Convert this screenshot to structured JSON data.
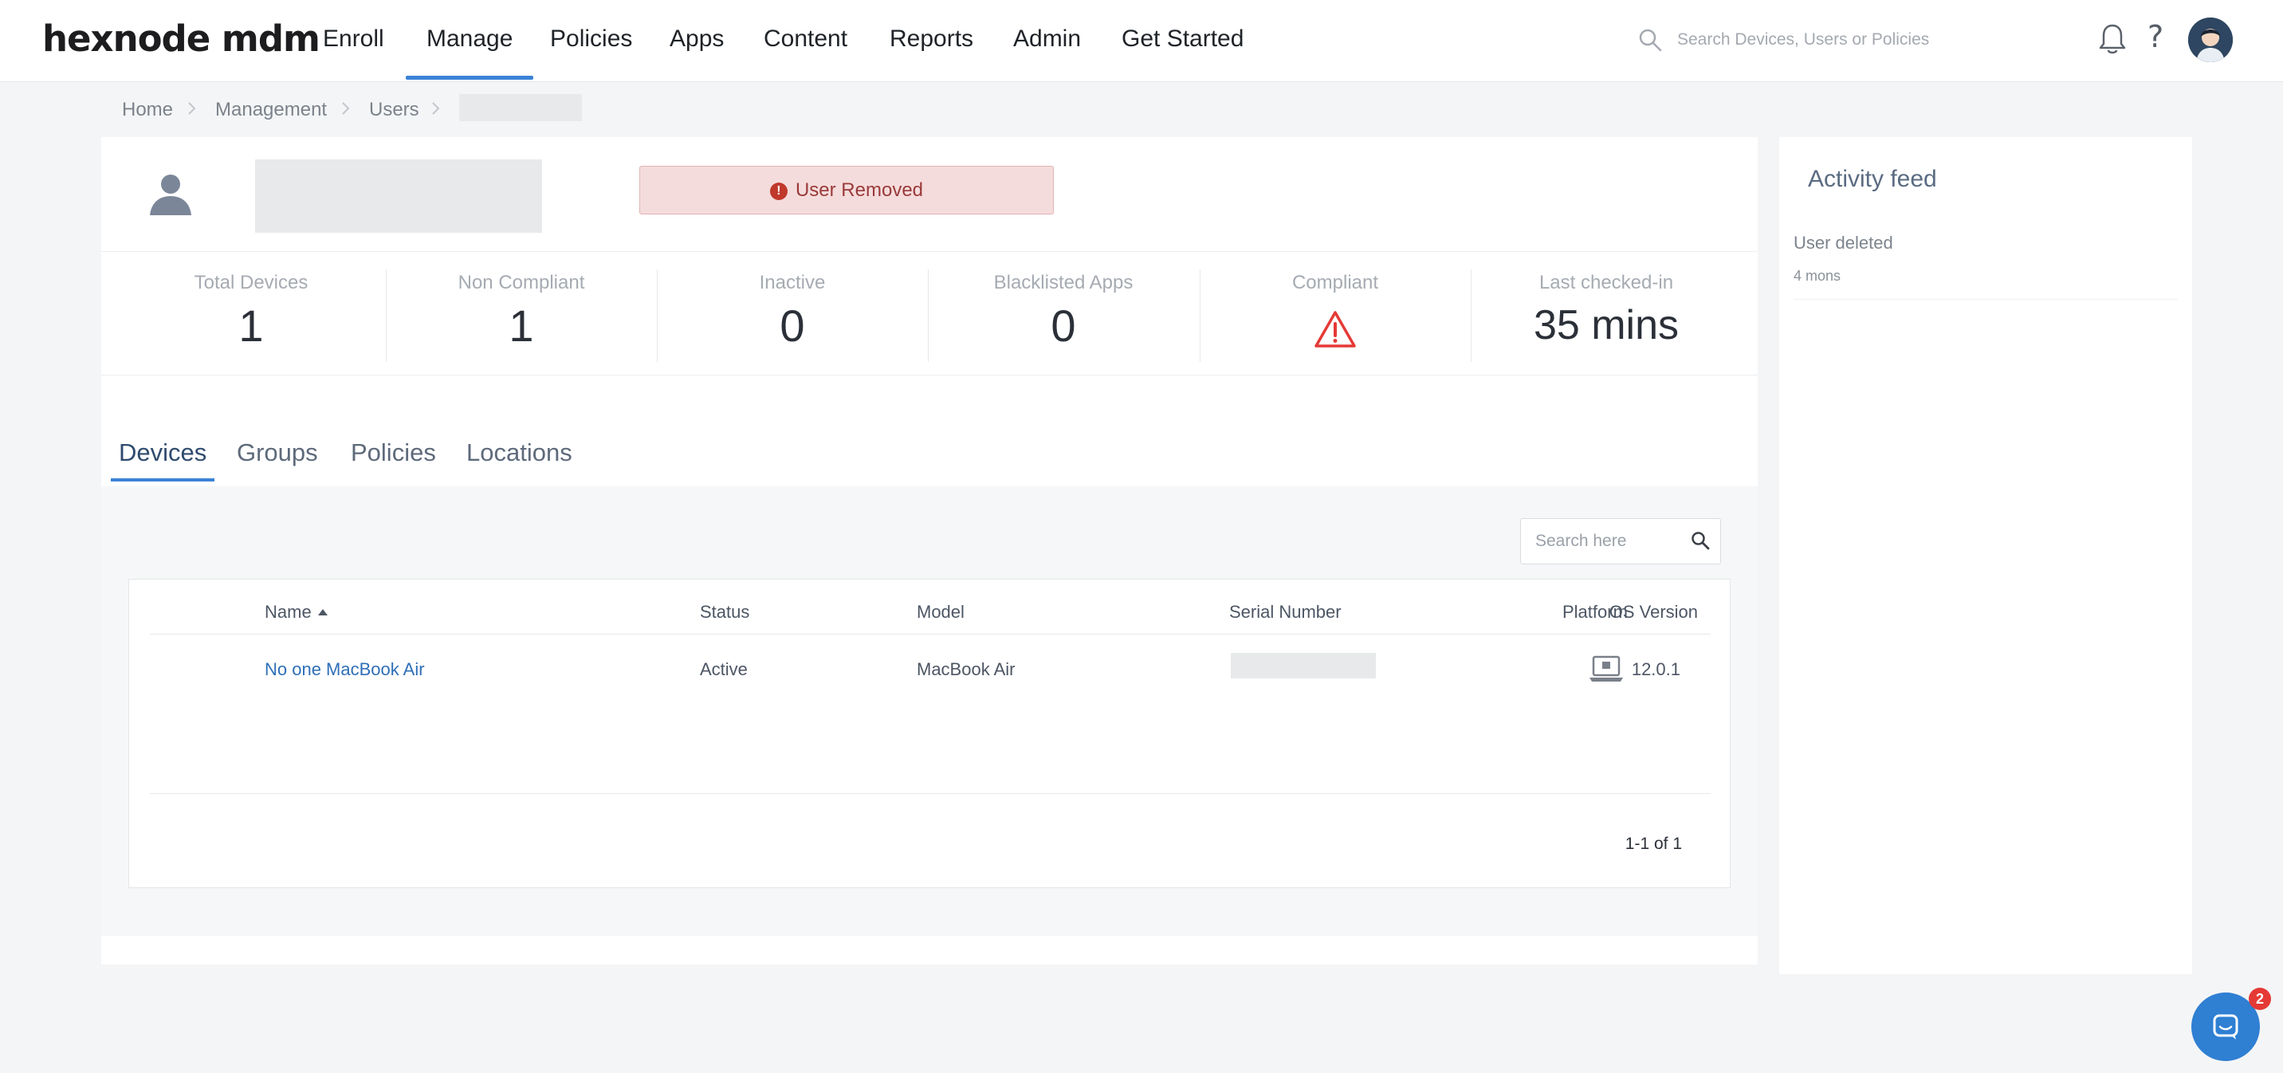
{
  "nav": {
    "logo": "hexnode mdm",
    "items": [
      "Enroll",
      "Manage",
      "Policies",
      "Apps",
      "Content",
      "Reports",
      "Admin",
      "Get Started"
    ],
    "active": "Manage",
    "search_placeholder": "Search Devices, Users or Policies",
    "help_glyph": "?",
    "icons": [
      "search-icon",
      "bell-icon",
      "help-icon",
      "avatar"
    ]
  },
  "breadcrumb": [
    "Home",
    "Management",
    "Users"
  ],
  "user": {
    "status_banner": "User Removed",
    "banner_icon": "!"
  },
  "stats": [
    {
      "label": "Total Devices",
      "value": "1"
    },
    {
      "label": "Non Compliant",
      "value": "1"
    },
    {
      "label": "Inactive",
      "value": "0"
    },
    {
      "label": "Blacklisted Apps",
      "value": "0"
    },
    {
      "label": "Compliant",
      "icon": "warning-icon"
    },
    {
      "label": "Last checked-in",
      "value": "35 mins"
    }
  ],
  "tabs": [
    "Devices",
    "Groups",
    "Policies",
    "Locations"
  ],
  "active_tab": "Devices",
  "devices_table": {
    "search_placeholder": "Search here",
    "columns": [
      "Name",
      "Status",
      "Model",
      "Serial Number",
      "Platform",
      "OS Version"
    ],
    "sorted_by": "Name",
    "rows": [
      {
        "name": "No one MacBook Air",
        "status": "Active",
        "model": "MacBook Air",
        "platform_icon": "macos-laptop-icon",
        "os_version": "12.0.1"
      }
    ],
    "pager": "1-1 of 1"
  },
  "activity_feed": {
    "title": "Activity feed",
    "items": [
      {
        "text": "User deleted",
        "time": "4 mons"
      }
    ]
  },
  "chat": {
    "badge": "2"
  },
  "colors": {
    "accent": "#3b82d6",
    "removed_bg": "#f5dcdc",
    "removed_text": "#9a3a3a",
    "warning": "#e53935",
    "link": "#2f6fb7"
  }
}
